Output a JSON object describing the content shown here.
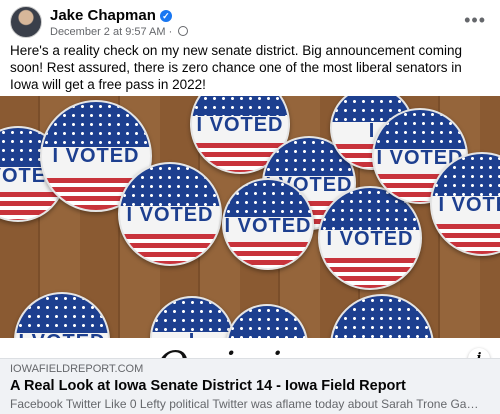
{
  "post": {
    "author": "Jake Chapman",
    "timestamp": "December 2 at 9:57 AM",
    "separator": "·",
    "text": "Here's a reality check on my new senate district. Big announcement coming soon! Rest assured, there is zero chance one of the most liberal senators in Iowa will get a free pass in 2022!",
    "more_glyph": "•••"
  },
  "image": {
    "sticker_label": "I VOTED",
    "banner_text": "Opinion",
    "colors": {
      "sticker_blue": "#1d3f8f",
      "sticker_red": "#c8333b",
      "table_wood": "#8a5a32"
    }
  },
  "link": {
    "domain": "IOWAFIELDREPORT.COM",
    "title": "A Real Look at Iowa Senate District 14 - Iowa Field Report",
    "description": "Facebook Twitter Like 0 Lefty political Twitter was aflame today about Sarah Trone Garri...",
    "info_glyph": "i"
  },
  "icons": [
    "avatar",
    "verified-badge-icon",
    "globe-icon",
    "more-options-icon",
    "info-icon"
  ]
}
